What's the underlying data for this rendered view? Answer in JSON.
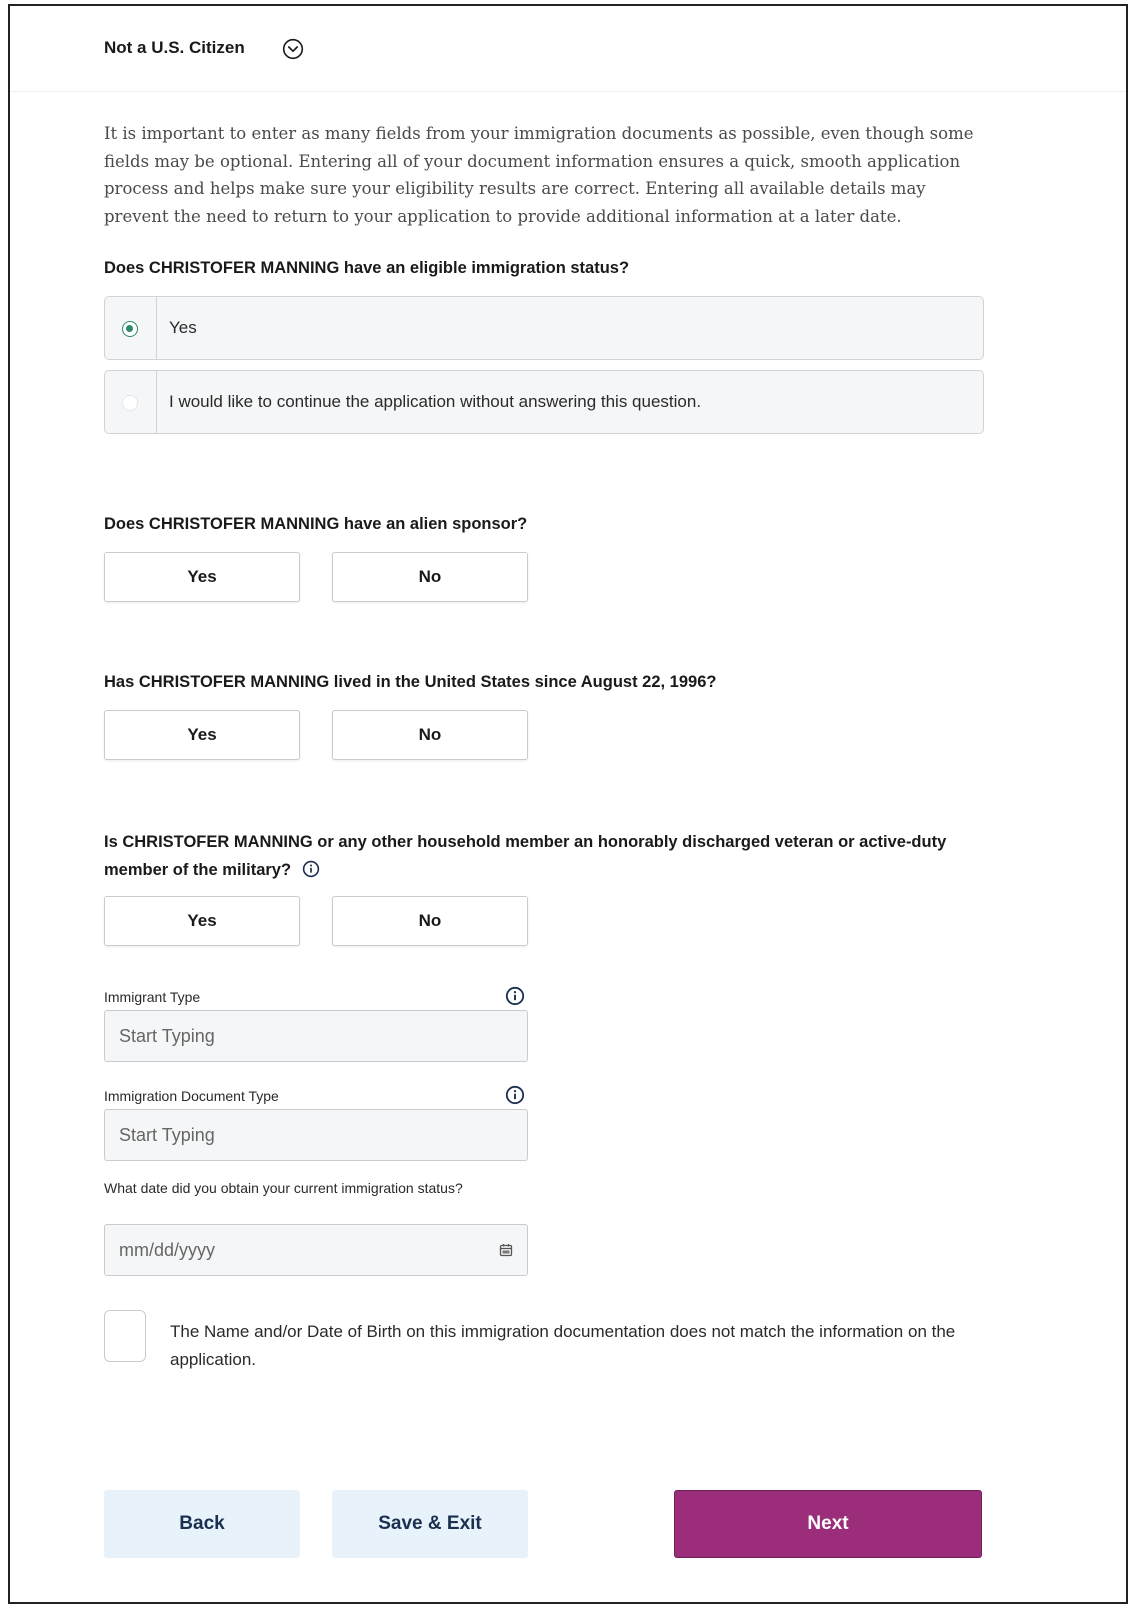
{
  "header": {
    "title": "Not a U.S. Citizen"
  },
  "intro": "It is important to enter as many fields from your immigration documents as possible, even though some fields may be optional. Entering all of your document information ensures a quick, smooth application process and helps make sure your eligibility results are correct. Entering all available details may prevent the need to return to your application to provide additional information at a later date.",
  "q_status": {
    "label": "Does CHRISTOFER MANNING have an eligible immigration status?",
    "options": [
      {
        "label": "Yes",
        "selected": true
      },
      {
        "label": "I would like to continue the application without answering this question.",
        "selected": false
      }
    ]
  },
  "q_sponsor": {
    "label": "Does CHRISTOFER MANNING have an alien sponsor?",
    "yes": "Yes",
    "no": "No"
  },
  "q_lived": {
    "label": "Has CHRISTOFER MANNING lived in the United States since August 22, 1996?",
    "yes": "Yes",
    "no": "No"
  },
  "q_veteran": {
    "label": "Is CHRISTOFER MANNING or any other household member an honorably discharged veteran or active-duty member of the military?",
    "yes": "Yes",
    "no": "No"
  },
  "immigrant_type": {
    "label": "Immigrant Type",
    "placeholder": "Start Typing"
  },
  "document_type": {
    "label": "Immigration Document Type",
    "placeholder": "Start Typing"
  },
  "status_date": {
    "label": "What date did you obtain your current immigration status?",
    "placeholder": "mm/dd/yyyy"
  },
  "mismatch_checkbox": {
    "label": "The Name and/or Date of Birth on this immigration documentation does not match the information on the application."
  },
  "footer": {
    "back": "Back",
    "save_exit": "Save & Exit",
    "next": "Next"
  },
  "colors": {
    "primary": "#9b2d7a",
    "radio_selected": "#2a8a6a",
    "info_icon": "#1b2f4f",
    "secondary_button_bg": "#e7f2fb"
  }
}
